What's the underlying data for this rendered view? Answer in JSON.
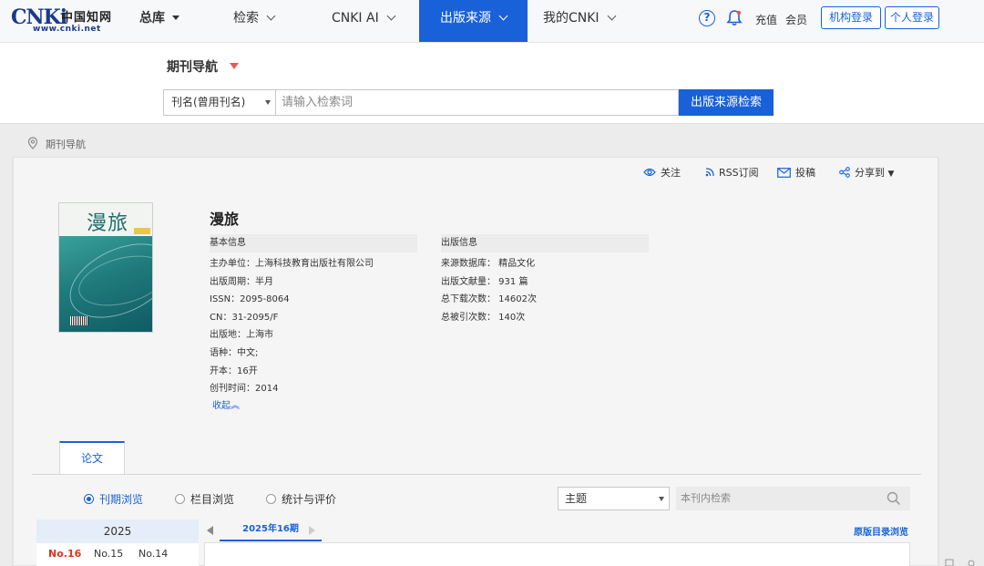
{
  "logo": {
    "mark": "CNKi",
    "cn": "中国知网",
    "url": "www.cnki.net"
  },
  "nav": {
    "library": "总库",
    "items": [
      {
        "label": "检索"
      },
      {
        "label": "CNKI AI"
      },
      {
        "label": "出版来源"
      },
      {
        "label": "我的CNKI"
      }
    ],
    "recharge": "充值",
    "member": "会员",
    "org_login": "机构登录",
    "personal_login": "个人登录"
  },
  "search": {
    "section_title": "期刊导航",
    "field": "刊名(曾用刊名)",
    "placeholder": "请输入检索词",
    "button": "出版来源检索"
  },
  "breadcrumb": "期刊导航",
  "actions": {
    "follow": "关注",
    "rss": "RSS订阅",
    "submit": "投稿",
    "share": "分享到"
  },
  "journal": {
    "cover_title": "漫旅",
    "title": "漫旅",
    "basic_head": "基本信息",
    "publish_head": "出版信息",
    "basic": [
      "主办单位：上海科技教育出版社有限公司",
      "出版周期：半月",
      "ISSN：2095-8064",
      "CN：31-2095/F",
      "出版地：上海市",
      "语种：中文;",
      "开本：16开",
      "创刊时间：2014"
    ],
    "publish": [
      "来源数据库：  精品文化",
      "出版文献量：  931 篇",
      "总下载次数：  14602次",
      "总被引次数：  140次"
    ],
    "collapse": "收起"
  },
  "tabs": {
    "papers": "论文"
  },
  "browse": {
    "issue_browse": "刊期浏览",
    "column_browse": "栏目浏览",
    "stats": "统计与评价",
    "topic": "主题",
    "inner_search_placeholder": "本刊内检索"
  },
  "issues": {
    "year": "2025",
    "list": [
      "No.16",
      "No.15",
      "No.14"
    ],
    "current_title": "2025年16期",
    "toc_link": "原版目录浏览"
  },
  "colors": {
    "accent": "#1961d9",
    "current_issue": "#d9361f",
    "caret": "#e85a4f"
  }
}
